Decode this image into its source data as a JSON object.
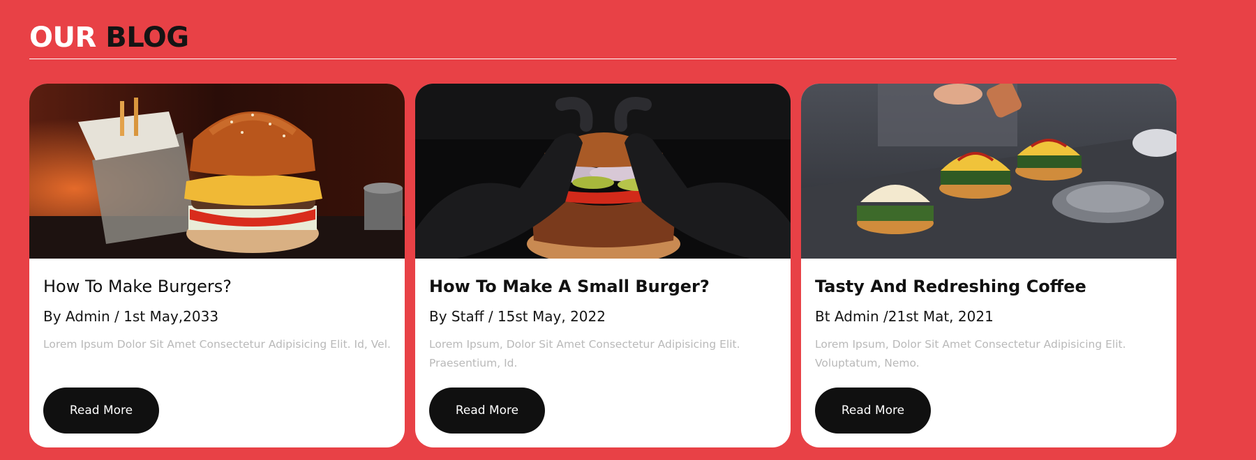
{
  "heading": {
    "word1": "OUR",
    "word2": "BLOG"
  },
  "colors": {
    "background": "#e84146",
    "card": "#ffffff",
    "button": "#101010",
    "excerpt": "#b9b9b9"
  },
  "cards": [
    {
      "image": "burger-with-fries-photo",
      "title": "How To Make Burgers?",
      "meta": "By Admin / 1st May,2033",
      "excerpt": "Lorem Ipsum Dolor Sit Amet Consectetur Adipisicing Elit. Id, Vel.",
      "button": "Read More"
    },
    {
      "image": "gloved-hands-burger-photo",
      "title": "How To Make A Small Burger?",
      "meta": "By Staff / 15st May, 2022",
      "excerpt": "Lorem Ipsum, Dolor Sit Amet Consectetur Adipisicing Elit. Praesentium, Id.",
      "button": "Read More"
    },
    {
      "image": "sliders-on-grill-photo",
      "title": "Tasty And Redreshing Coffee",
      "meta": "Bt Admin /21st Mat, 2021",
      "excerpt": "Lorem Ipsum, Dolor Sit Amet Consectetur Adipisicing Elit. Voluptatum, Nemo.",
      "button": "Read More"
    }
  ]
}
